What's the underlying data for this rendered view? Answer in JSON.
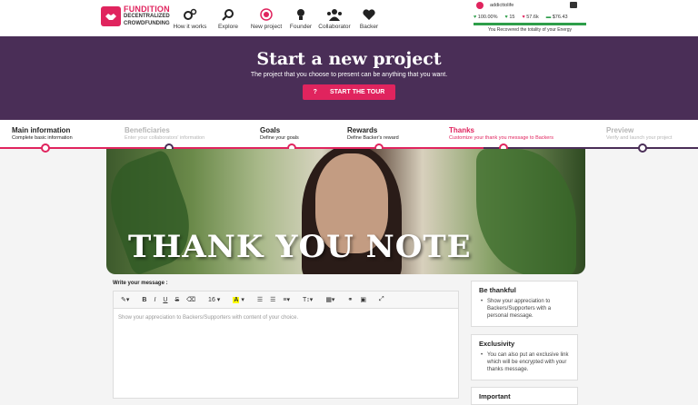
{
  "brand": {
    "name": "FUNDITION",
    "line2": "DECENTRALIZED",
    "line3": "CROWDFUNDING"
  },
  "nav": [
    {
      "label": "How it works",
      "icon": "gears-icon"
    },
    {
      "label": "Explore",
      "icon": "search-icon"
    },
    {
      "label": "New project",
      "icon": "target-icon"
    },
    {
      "label": "Founder",
      "icon": "lightbulb-icon"
    },
    {
      "label": "Collaborator",
      "icon": "users-icon"
    },
    {
      "label": "Backer",
      "icon": "heart-icon"
    }
  ],
  "user": {
    "name": "addicttolife",
    "power": "100.00%",
    "votes": "15",
    "likes": "57.6k",
    "balance": "$76.43",
    "energy_note": "You Recovered the totality of your Energy",
    "energy_fraction": 1.0
  },
  "hero": {
    "title": "Start a new project",
    "subtitle": "The project that you choose to present can be anything that you want.",
    "tour_icon": "?",
    "tour_label": "START THE TOUR"
  },
  "steps": [
    {
      "title": "Main information",
      "desc": "Complete basic information",
      "state": "done"
    },
    {
      "title": "Beneficiaries",
      "desc": "Enter your collaborators' information",
      "state": "muted"
    },
    {
      "title": "Goals",
      "desc": "Define your goals",
      "state": "done"
    },
    {
      "title": "Rewards",
      "desc": "Define Backer's reward",
      "state": "done"
    },
    {
      "title": "Thanks",
      "desc": "Customize your thank you message to Backers",
      "state": "active"
    },
    {
      "title": "Preview",
      "desc": "Verify and launch your project",
      "state": "muted"
    }
  ],
  "banner": {
    "title": "THANK YOU NOTE"
  },
  "editor": {
    "label": "Write your message :",
    "font_size": "16",
    "placeholder": "Show your appreciation to Backers/Supporters with content of your choice."
  },
  "panels": [
    {
      "title": "Be thankful",
      "text": "Show your appreciation to Backers/Supporters with a personal message."
    },
    {
      "title": "Exclusivity",
      "text": "You can also put an exclusive link which will be encrypted with your thanks message."
    },
    {
      "title": "Important",
      "text": ""
    }
  ],
  "colors": {
    "accent": "#e0245e",
    "purple": "#4a2e57",
    "green": "#2e9e4a"
  }
}
